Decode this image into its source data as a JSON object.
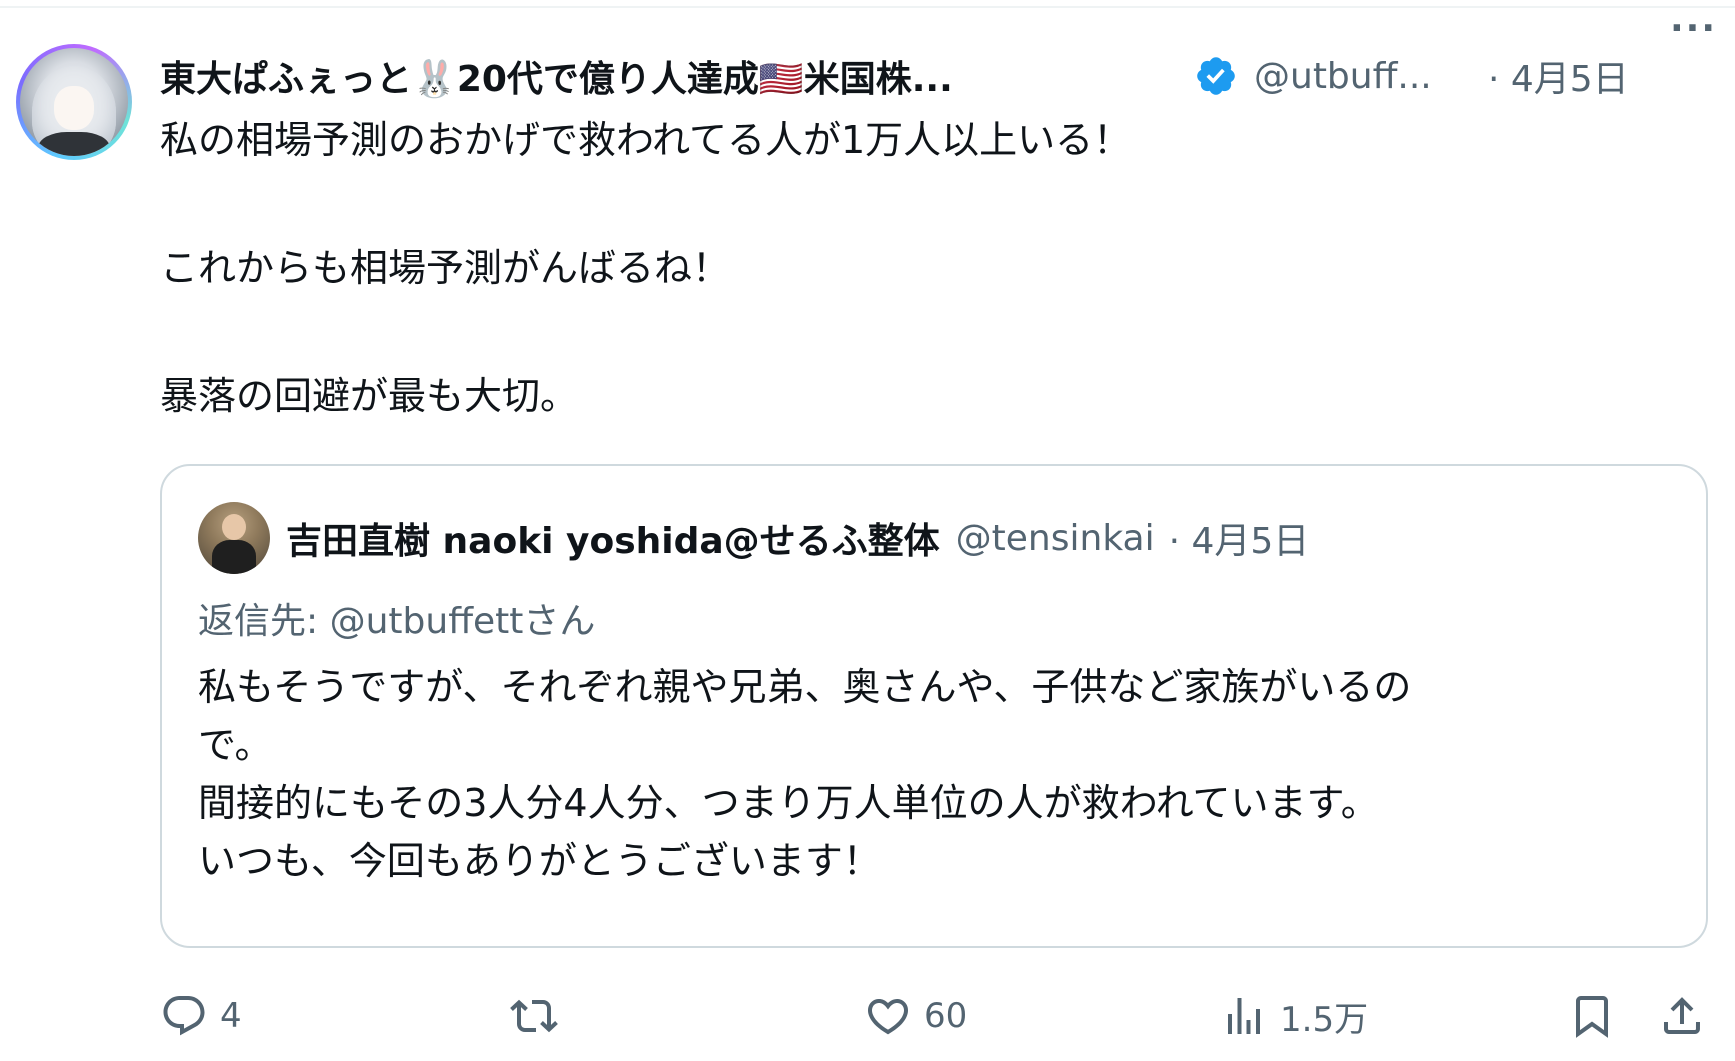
{
  "tweet": {
    "display_name": "東大ぱふぇっと🐰20代で億り人達成🇺🇸米国株...",
    "handle": "@utbuff...",
    "separator_date": "· 4月5日",
    "more_label": "···",
    "text_lines": [
      "私の相場予測のおかげで救われてる人が1万人以上いる！",
      "これからも相場予測がんばるね！",
      "暴落の回避が最も大切。"
    ]
  },
  "quote": {
    "display_name": "吉田直樹 naoki yoshida@せるふ整体",
    "handle": "@tensinkai",
    "separator_date": "· 4月5日",
    "reply_prefix": "返信先:",
    "reply_target": "@utbuffettさん",
    "body_lines": [
      "私もそうですが、それぞれ親や兄弟、奥さんや、子供など家族がいるの",
      "で。",
      "間接的にもその3人分4人分、つまり万人単位の人が救われています。",
      "いつも、今回もありがとうございます！"
    ]
  },
  "actions": {
    "reply_count": "4",
    "retweet_count": "",
    "like_count": "60",
    "views_count": "1.5万"
  },
  "colors": {
    "text": "#0f1419",
    "secondary": "#536471",
    "border": "#cfd9de",
    "verified": "#1d9bf0"
  },
  "icons": {
    "verified": "verified-badge-icon",
    "reply": "reply-icon",
    "retweet": "retweet-icon",
    "like": "heart-icon",
    "views": "views-icon",
    "bookmark": "bookmark-icon",
    "share": "share-icon",
    "more": "more-icon"
  }
}
